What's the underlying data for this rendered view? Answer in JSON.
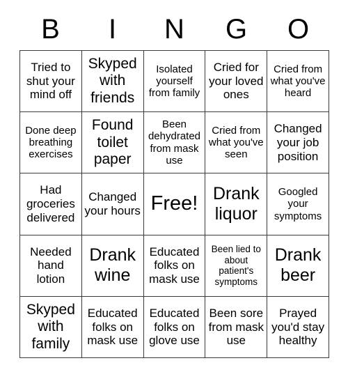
{
  "header": {
    "letters": [
      "B",
      "I",
      "N",
      "G",
      "O"
    ]
  },
  "grid": {
    "rows": 5,
    "columns": 5,
    "border_color": "#3a3a3a",
    "cell_background": "#ffffff",
    "text_color": "#000000",
    "cells": [
      {
        "text": "Tried to shut your mind off",
        "size": "md"
      },
      {
        "text": "Skyped with friends",
        "size": "lg"
      },
      {
        "text": "Isolated yourself from family",
        "size": "sm"
      },
      {
        "text": "Cried for your loved ones",
        "size": "md"
      },
      {
        "text": "Cried from what you've heard",
        "size": "sm"
      },
      {
        "text": "Done deep breathing exercises",
        "size": "sm"
      },
      {
        "text": "Found toilet paper",
        "size": "lg"
      },
      {
        "text": "Been dehydrated from mask use",
        "size": "sm"
      },
      {
        "text": "Cried from what you've seen",
        "size": "sm"
      },
      {
        "text": "Changed your job position",
        "size": "md"
      },
      {
        "text": "Had groceries delivered",
        "size": "md"
      },
      {
        "text": "Changed your hours",
        "size": "md"
      },
      {
        "text": "Free!",
        "size": "xxl"
      },
      {
        "text": "Drank liquor",
        "size": "xl"
      },
      {
        "text": "Googled your symptoms",
        "size": "sm"
      },
      {
        "text": "Needed hand lotion",
        "size": "md"
      },
      {
        "text": "Drank wine",
        "size": "xl"
      },
      {
        "text": "Educated folks on mask use",
        "size": "md"
      },
      {
        "text": "Been lied to about patient's symptoms",
        "size": "xs"
      },
      {
        "text": "Drank beer",
        "size": "xl"
      },
      {
        "text": "Skyped with family",
        "size": "lg"
      },
      {
        "text": "Educated folks on mask use",
        "size": "md"
      },
      {
        "text": "Educated folks on glove use",
        "size": "md"
      },
      {
        "text": "Been sore from mask use",
        "size": "md"
      },
      {
        "text": "Prayed you'd stay healthy",
        "size": "md"
      }
    ]
  }
}
